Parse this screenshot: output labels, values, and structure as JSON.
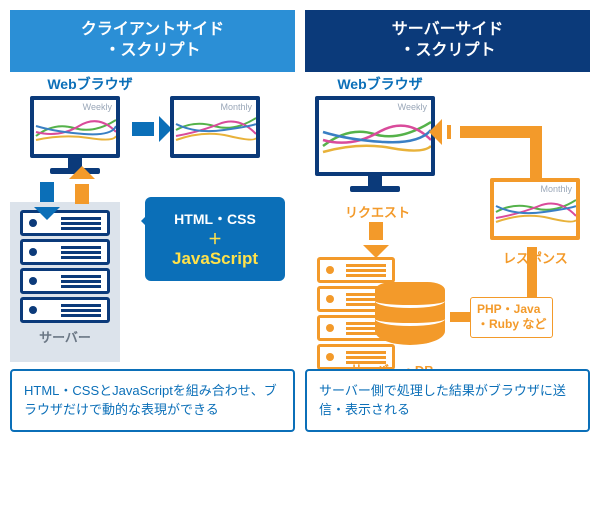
{
  "left": {
    "header": "クライアントサイド\n・スクリプト",
    "browser_label": "Webブラウザ",
    "chart1": "Weekly",
    "chart2": "Monthly",
    "server_label": "サーバー",
    "callout_line1": "HTML・CSS",
    "callout_plus": "＋",
    "callout_js": "JavaScript",
    "footnote": "HTML・CSSとJavaScriptを組み合わせ、ブラウザだけで動的な表現ができる"
  },
  "right": {
    "header": "サーバーサイド\n・スクリプト",
    "browser_label": "Webブラウザ",
    "chart1": "Weekly",
    "chart2": "Monthly",
    "request": "リクエスト",
    "response": "レスポンス",
    "server_db": "サーバー・DB",
    "tech": "PHP・Java\n・Ruby など",
    "footnote": "サーバー側で処理した結果がブラウザに送信・表示される"
  }
}
